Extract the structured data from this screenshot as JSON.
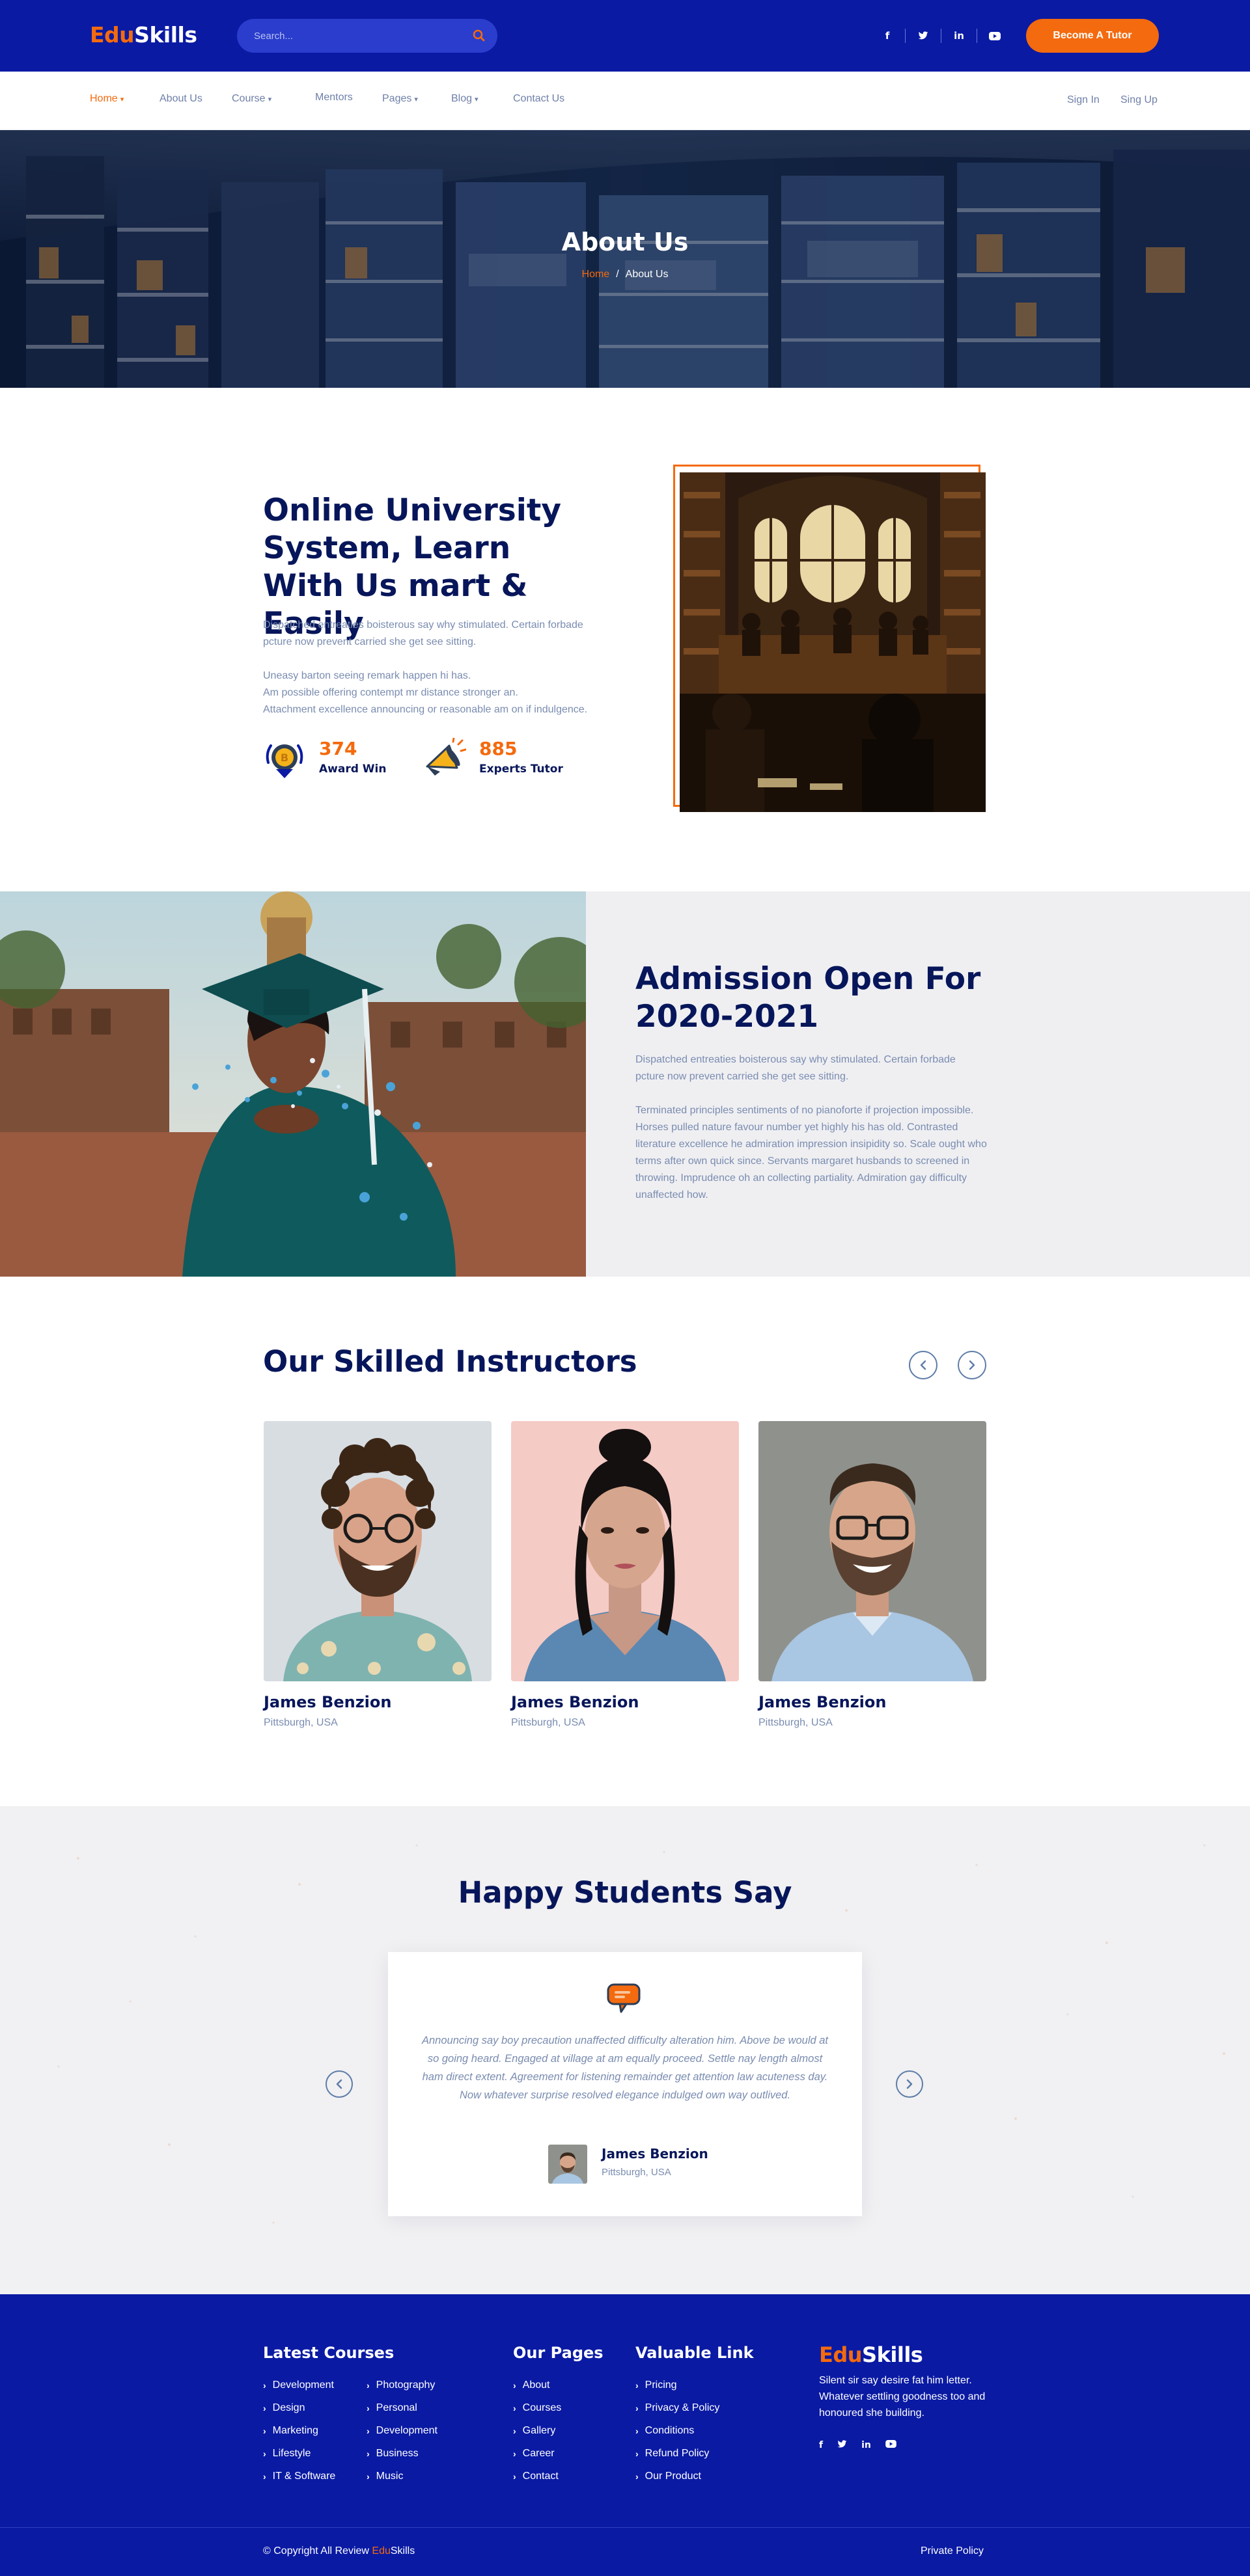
{
  "brand": {
    "part1": "Edu",
    "part2": "Skills",
    "accent": "#f46a0e",
    "primary": "#0a1aa3",
    "heading": "#07165a"
  },
  "topbar": {
    "search_placeholder": "Search...",
    "social": [
      "facebook-icon",
      "twitter-icon",
      "linkedin-icon",
      "youtube-icon"
    ],
    "cta": "Become A Tutor"
  },
  "nav": {
    "items": [
      {
        "label": "Home",
        "active": true,
        "dropdown": true
      },
      {
        "label": "About Us",
        "active": false,
        "dropdown": false
      },
      {
        "label": "Course",
        "active": false,
        "dropdown": true
      },
      {
        "label": "Mentors",
        "active": false,
        "dropdown": false
      },
      {
        "label": "Pages",
        "active": false,
        "dropdown": true
      },
      {
        "label": "Blog",
        "active": false,
        "dropdown": true
      },
      {
        "label": "Contact Us",
        "active": false,
        "dropdown": false
      }
    ],
    "sign_in": "Sign In",
    "sign_up": "Sing Up"
  },
  "hero": {
    "title": "About Us",
    "crumb_home": "Home",
    "crumb_current": "About Us"
  },
  "about": {
    "heading": "Online University System, Learn With Us mart & Easily",
    "para1": "Dispatched entreaties boisterous say why stimulated. Certain forbade pcture now prevent carried she get see sitting.",
    "para2_line1": "Uneasy barton seeing remark happen hi has.",
    "para2_line2": "Am possible offering contempt mr distance stronger an.",
    "para2_line3": "Attachment excellence announcing or reasonable am on if indulgence.",
    "stat1": {
      "number": "374",
      "label": "Award  Win"
    },
    "stat2": {
      "number": "885",
      "label": "Experts Tutor"
    }
  },
  "admission": {
    "heading": "Admission Open For 2020-2021",
    "para1": "Dispatched entreaties boisterous say why stimulated. Certain forbade pcture now prevent carried she get see sitting.",
    "para2": "Terminated principles sentiments of no pianoforte if projection impossible. Horses pulled nature favour number yet highly his has old. Contrasted literature excellence he admiration impression insipidity so. Scale ought who terms after own quick since. Servants margaret husbands to screened in throwing. Imprudence oh an collecting partiality. Admiration gay difficulty unaffected how."
  },
  "instructors": {
    "title": "Our Skilled Instructors",
    "items": [
      {
        "name": "James Benzion",
        "location": "Pittsburgh, USA"
      },
      {
        "name": "James Benzion",
        "location": "Pittsburgh, USA"
      },
      {
        "name": "James Benzion",
        "location": "Pittsburgh, USA"
      }
    ]
  },
  "testimonials": {
    "title": "Happy Students Say",
    "quote": "Announcing say boy precaution unaffected difficulty alteration him. Above be would at so going heard. Engaged at village at am equally proceed. Settle nay length almost ham direct extent. Agreement for listening remainder get attention law acuteness day. Now whatever surprise resolved elegance indulged own way outlived.",
    "name": "James Benzion",
    "location": "Pittsburgh, USA"
  },
  "footer": {
    "courses_title": "Latest Courses",
    "courses_col1": [
      "Development",
      "Design",
      "Marketing",
      "Lifestyle",
      "IT & Software"
    ],
    "courses_col2": [
      "Photography",
      "Personal",
      "Development",
      "Business",
      "Music"
    ],
    "pages_title": "Our Pages",
    "pages": [
      "About",
      "Courses",
      "Gallery",
      "Career",
      "Contact"
    ],
    "links_title": "Valuable Link",
    "links": [
      "Pricing",
      "Privacy & Policy",
      "Conditions",
      "Refund Policy",
      "Our Product"
    ],
    "description": "Silent sir say desire fat him letter. Whatever settling goodness too and honoured she building.",
    "copyright_prefix": "© Copyright All Review ",
    "privacy": "Private Policy"
  }
}
